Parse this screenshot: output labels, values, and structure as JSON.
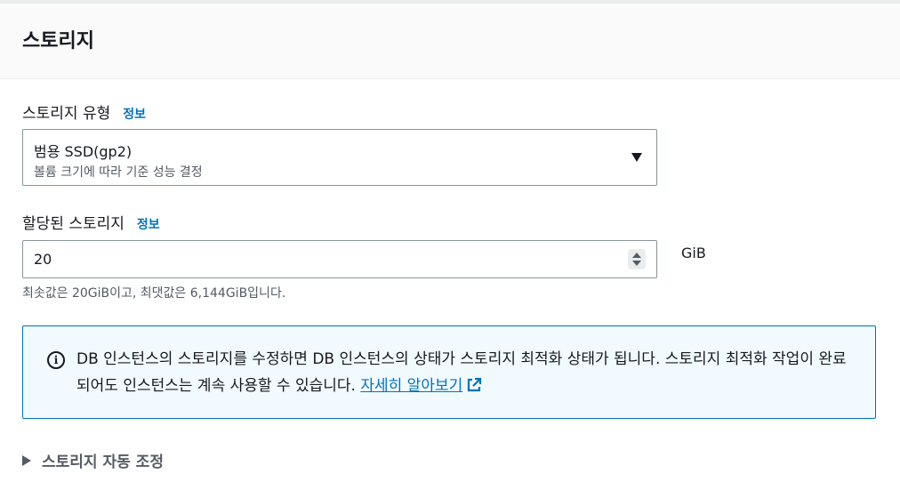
{
  "section": {
    "title": "스토리지"
  },
  "storage_type": {
    "label": "스토리지 유형",
    "info": "정보",
    "selected": "범용 SSD(gp2)",
    "description": "볼륨 크기에 따라 기준 성능 결정"
  },
  "allocated_storage": {
    "label": "할당된 스토리지",
    "info": "정보",
    "value": "20",
    "unit": "GiB",
    "constraint": "최솟값은 20GiB이고, 최댓값은 6,144GiB입니다."
  },
  "alert": {
    "text": "DB 인스턴스의 스토리지를 수정하면 DB 인스턴스의 상태가 스토리지 최적화 상태가 됩니다. 스토리지 최적화 작업이 완료되어도 인스턴스는 계속 사용할 수 있습니다. ",
    "link": "자세히 알아보기",
    "icon": "info-icon"
  },
  "autoscaling": {
    "label": "스토리지 자동 조정"
  },
  "colors": {
    "link": "#0073bb",
    "alert_bg": "#f1faff",
    "alert_border": "#0073bb"
  }
}
